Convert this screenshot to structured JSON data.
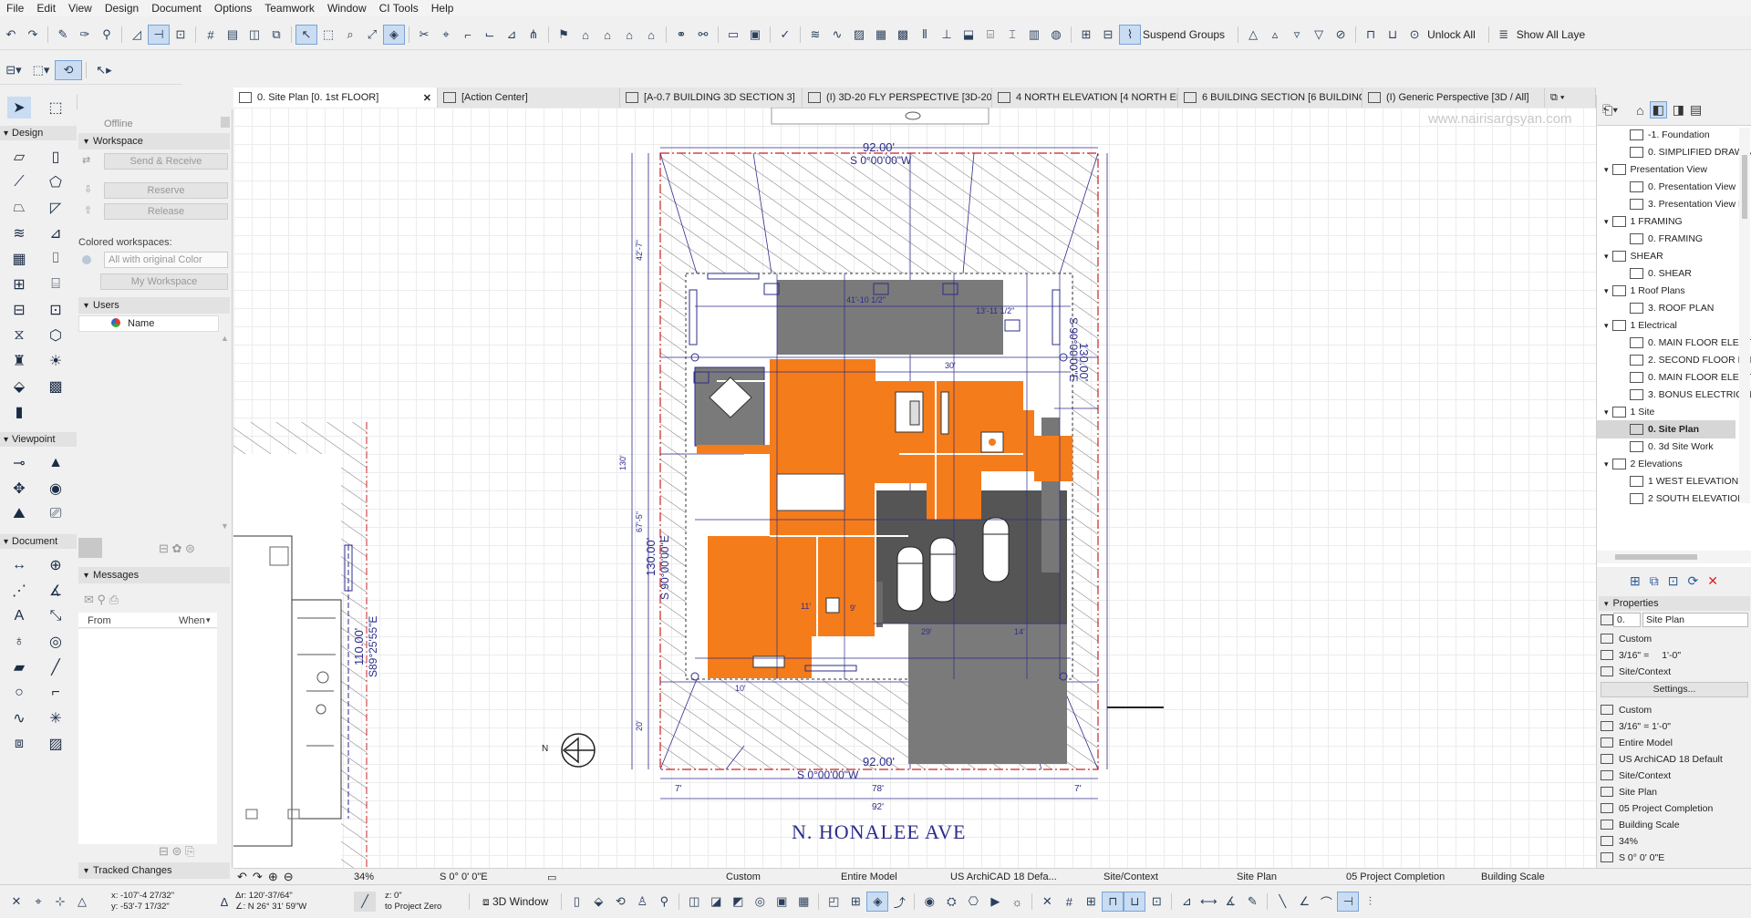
{
  "menu": [
    "File",
    "Edit",
    "View",
    "Design",
    "Document",
    "Options",
    "Teamwork",
    "Window",
    "CI Tools",
    "Help"
  ],
  "toolbar": {
    "suspend_groups": "Suspend Groups",
    "unlock_all": "Unlock All",
    "show_all_layers": "Show All Laye"
  },
  "tabs": [
    {
      "label": "0. Site Plan [0. 1st FLOOR]",
      "active": true
    },
    {
      "label": "[Action Center]"
    },
    {
      "label": "[A-0.7 BUILDING 3D SECTION 3]"
    },
    {
      "label": "(I) 3D-20 FLY PERSPECTIVE [3D-20 ..."
    },
    {
      "label": "4 NORTH ELEVATION [4 NORTH EL..."
    },
    {
      "label": "6 BUILDING SECTION [6 BUILDING ..."
    },
    {
      "label": "(I) Generic Perspective [3D / All]"
    }
  ],
  "toolbox": {
    "sections": {
      "design": "Design",
      "viewpoint": "Viewpoint",
      "document": "Document"
    }
  },
  "teamwork": {
    "status": "Offline",
    "workspace_header": "Workspace",
    "send_receive": "Send & Receive",
    "reserve": "Reserve",
    "release": "Release",
    "colored_workspaces_label": "Colored workspaces:",
    "colored_workspaces_value": "All with original Color",
    "my_workspace": "My Workspace",
    "users_header": "Users",
    "users_column": "Name",
    "messages_header": "Messages",
    "messages_from": "From",
    "messages_when": "When",
    "tracked_changes": "Tracked Changes"
  },
  "canvas": {
    "watermark": "www.nairisargsyan.com",
    "street_label": "N. HONALEE AVE",
    "north_symbol": "N",
    "dims": {
      "top_width": "92.00'",
      "top_bearing": "S 0°00'00\"W",
      "bottom_width": "92.00'",
      "bottom_bearing": "S 0°00'00\"W",
      "right_len": "130.00'",
      "right_bearing": "S 90°00'00\"E",
      "left_len": "130.00'",
      "left_bearing": "S 90°00'00\"E",
      "neighbor_len": "110.00'",
      "neighbor_bearing": "S89°25'55\"E",
      "dim_78": "78'",
      "dim_92": "92'",
      "dim_7a": "7'",
      "dim_7b": "7'",
      "dim_130": "130'",
      "dim_67": "67'-5\"",
      "dim_42": "42'-7\"",
      "dim_20": "20'",
      "dim_41": "41'-10 1/2\"",
      "dim_13": "13'-11 1/2\"",
      "dim_30": "30'",
      "dim_29": "29'",
      "dim_14": "14'",
      "dim_11": "11'",
      "dim_9": "9'",
      "dim_10": "10'"
    }
  },
  "navigator": {
    "items": [
      {
        "label": "-1. Foundation",
        "level": 2
      },
      {
        "label": "0. SIMPLIFIED DRAWIN",
        "level": 2
      },
      {
        "label": "Presentation View",
        "level": 1
      },
      {
        "label": "0. Presentation View",
        "level": 2
      },
      {
        "label": "3. Presentation View B",
        "level": 2
      },
      {
        "label": "1 FRAMING",
        "level": 1
      },
      {
        "label": "0. FRAMING",
        "level": 2
      },
      {
        "label": "SHEAR",
        "level": 1
      },
      {
        "label": "0. SHEAR",
        "level": 2
      },
      {
        "label": "1 Roof Plans",
        "level": 1
      },
      {
        "label": "3. ROOF PLAN",
        "level": 2
      },
      {
        "label": "1 Electrical",
        "level": 1
      },
      {
        "label": "0. MAIN FLOOR ELECT",
        "level": 2
      },
      {
        "label": "2. SECOND FLOOR ELI",
        "level": 2
      },
      {
        "label": "0. MAIN FLOOR ELECT",
        "level": 2
      },
      {
        "label": "3. BONUS ELECTRICAL",
        "level": 2
      },
      {
        "label": "1 Site",
        "level": 1
      },
      {
        "label": "0. Site Plan",
        "level": 2,
        "selected": true
      },
      {
        "label": "0. 3d Site Work",
        "level": 2
      },
      {
        "label": "2 Elevations",
        "level": 1
      },
      {
        "label": "1 WEST ELEVATION",
        "level": 2
      },
      {
        "label": "2 SOUTH ELEVATION",
        "level": 2
      }
    ]
  },
  "properties": {
    "header": "Properties",
    "id": "0.",
    "name": "Site Plan",
    "custom": "Custom",
    "scale_a": "3/16\" =",
    "scale_b": "1'-0\"",
    "context": "Site/Context",
    "settings": "Settings...",
    "rows": [
      "Custom",
      "3/16\" =   1'-0\"",
      "Entire Model",
      "US ArchiCAD 18 Default",
      "Site/Context",
      "Site Plan",
      "05 Project Completion",
      "Building Scale",
      "34%",
      "S 0° 0' 0\"E"
    ]
  },
  "status": {
    "zoom": "34%",
    "angle": "S 0° 0' 0\"E",
    "custom": "Custom",
    "model": "Entire Model",
    "pen": "US ArchiCAD 18 Defa...",
    "layer": "Site/Context",
    "plan": "Site Plan",
    "renovation": "05 Project Completion",
    "scale": "Building Scale"
  },
  "bottom": {
    "x": "x: -107'-4 27/32\"",
    "y": "y: -53'-7 17/32\"",
    "dr": "Δr: 120'-37/64\"",
    "da": "∠: N 26° 31' 59\"W",
    "z": "z: 0\"",
    "ref": "to Project Zero",
    "view3d": "3D Window"
  }
}
